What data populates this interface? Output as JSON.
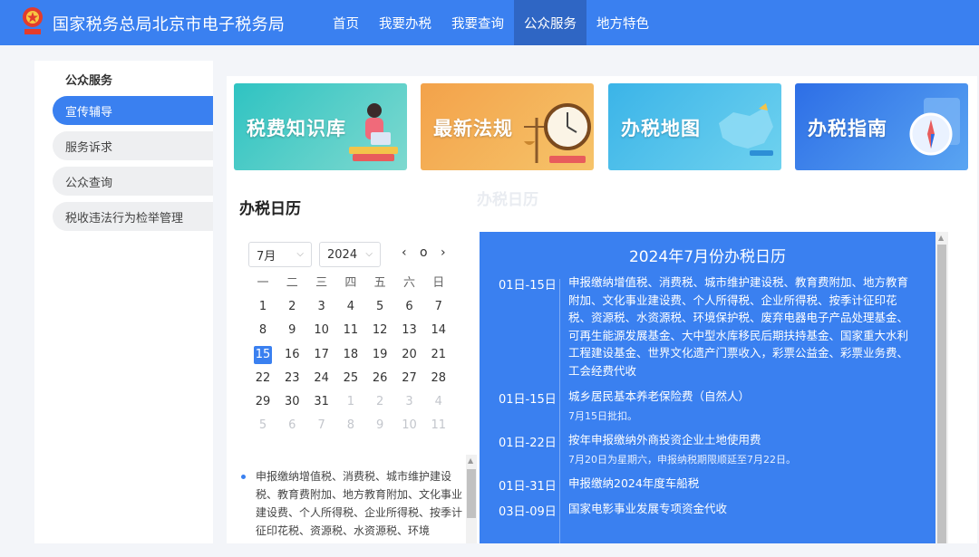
{
  "header": {
    "title": "国家税务总局北京市电子税务局"
  },
  "nav": [
    "首页",
    "我要办税",
    "我要查询",
    "公众服务",
    "地方特色"
  ],
  "sidebar": {
    "heading": "公众服务",
    "items": [
      "宣传辅导",
      "服务诉求",
      "公众查询",
      "税收违法行为检举管理"
    ]
  },
  "banners": [
    "税费知识库",
    "最新法规",
    "办税地图",
    "办税指南"
  ],
  "calendar": {
    "title": "办税日历",
    "month": "7月",
    "year": "2024",
    "nav": {
      "prev": "‹",
      "today": "o",
      "next": "›"
    },
    "weekdays": [
      "一",
      "二",
      "三",
      "四",
      "五",
      "六",
      "日"
    ],
    "weeks": [
      [
        "1",
        "2",
        "3",
        "4",
        "5",
        "6",
        "7"
      ],
      [
        "8",
        "9",
        "10",
        "11",
        "12",
        "13",
        "14"
      ],
      [
        "15",
        "16",
        "17",
        "18",
        "19",
        "20",
        "21"
      ],
      [
        "22",
        "23",
        "24",
        "25",
        "26",
        "27",
        "28"
      ],
      [
        "29",
        "30",
        "31",
        "1",
        "2",
        "3",
        "4"
      ],
      [
        "5",
        "6",
        "7",
        "8",
        "9",
        "10",
        "11"
      ]
    ],
    "selected": "15",
    "event_text": "申报缴纳增值税、消费税、城市维护建设税、教育费附加、地方教育附加、文化事业建设费、个人所得税、企业所得税、按季计征印花税、资源税、水资源税、环境"
  },
  "panel": {
    "ghost_title": "办税日历",
    "title": "2024年7月份办税日历",
    "entries": [
      {
        "date": "01日-15日",
        "desc": "申报缴纳增值税、消费税、城市维护建设税、教育费附加、地方教育附加、文化事业建设费、个人所得税、企业所得税、按季计征印花税、资源税、水资源税、环境保护税、废弃电器电子产品处理基金、可再生能源发展基金、大中型水库移民后期扶持基金、国家重大水利工程建设基金、世界文化遗产门票收入，彩票公益金、彩票业务费、工会经费代收",
        "note": ""
      },
      {
        "date": "01日-15日",
        "desc": "城乡居民基本养老保险费（自然人）",
        "note": "7月15日批扣。"
      },
      {
        "date": "01日-22日",
        "desc": "按年申报缴纳外商投资企业土地使用费",
        "note": "7月20日为星期六，申报纳税期限顺延至7月22日。"
      },
      {
        "date": "01日-31日",
        "desc": "申报缴纳2024年度车船税",
        "note": ""
      },
      {
        "date": "03日-09日",
        "desc": "国家电影事业发展专项资金代收",
        "note": ""
      }
    ]
  },
  "colors": {
    "primary": "#3a80f0",
    "nav_active": "#2f66c4"
  }
}
